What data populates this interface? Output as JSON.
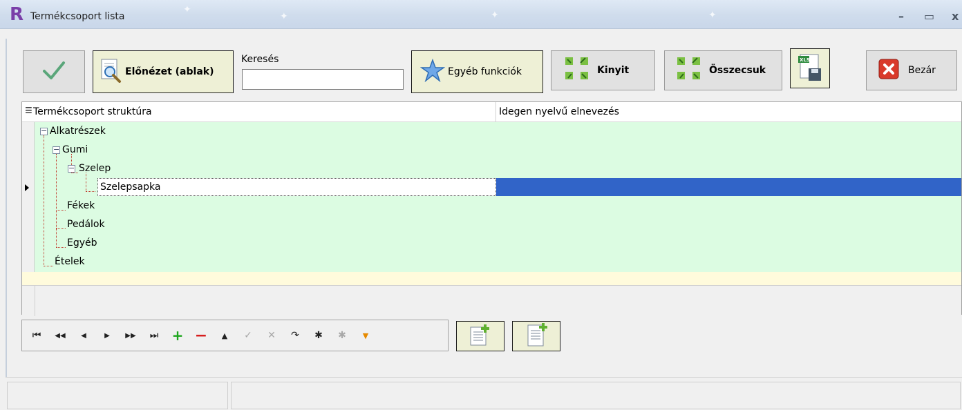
{
  "window": {
    "app_logo": "R",
    "title": "Termékcsoport lista",
    "minimize": "–",
    "maximize": "▭",
    "close": "x"
  },
  "toolbar": {
    "preview_label": "Előnézet (ablak)",
    "search_label": "Keresés",
    "search_value": "",
    "other_functions_label": "Egyéb funkciók",
    "expand_label": "Kinyit",
    "collapse_label": "Összecsuk",
    "close_label": "Bezár"
  },
  "grid": {
    "columns": [
      "Termékcsoport struktúra",
      "Idegen nyelvű elnevezés"
    ],
    "rows": [
      {
        "label": "Alkatrészek",
        "level": 0,
        "expanded": true
      },
      {
        "label": "Gumi",
        "level": 1,
        "expanded": true
      },
      {
        "label": "Szelep",
        "level": 2,
        "expanded": true
      },
      {
        "label": "Szelepsapka",
        "level": 3,
        "selected": true
      },
      {
        "label": "Fékek",
        "level": 1
      },
      {
        "label": "Pedálok",
        "level": 1
      },
      {
        "label": "Egyéb",
        "level": 1
      },
      {
        "label": "Ételek",
        "level": 0
      }
    ]
  },
  "navigator": {
    "buttons": [
      {
        "icon": "first-record-icon",
        "glyph": "⏮",
        "enabled": true
      },
      {
        "icon": "prev-page-icon",
        "glyph": "◀◀",
        "enabled": true
      },
      {
        "icon": "prev-record-icon",
        "glyph": "◀",
        "enabled": true
      },
      {
        "icon": "next-record-icon",
        "glyph": "▶",
        "enabled": true
      },
      {
        "icon": "next-page-icon",
        "glyph": "▶▶",
        "enabled": true
      },
      {
        "icon": "last-record-icon",
        "glyph": "⏭",
        "enabled": true
      },
      {
        "icon": "insert-icon",
        "glyph": "+",
        "enabled": true
      },
      {
        "icon": "delete-icon",
        "glyph": "−",
        "enabled": true
      },
      {
        "icon": "edit-icon",
        "glyph": "▲",
        "enabled": true
      },
      {
        "icon": "post-icon",
        "glyph": "✓",
        "enabled": false
      },
      {
        "icon": "cancel-icon",
        "glyph": "✕",
        "enabled": false
      },
      {
        "icon": "refresh-icon",
        "glyph": "↷",
        "enabled": true
      },
      {
        "icon": "bookmark-icon",
        "glyph": "✱",
        "enabled": true
      },
      {
        "icon": "goto-bookmark-icon",
        "glyph": "✱",
        "enabled": false
      },
      {
        "icon": "filter-icon",
        "glyph": "▼",
        "enabled": true
      }
    ]
  },
  "colors": {
    "tree_background": "#dcfce2",
    "selection": "#3164c8",
    "highlight_button": "#eef0d6"
  }
}
